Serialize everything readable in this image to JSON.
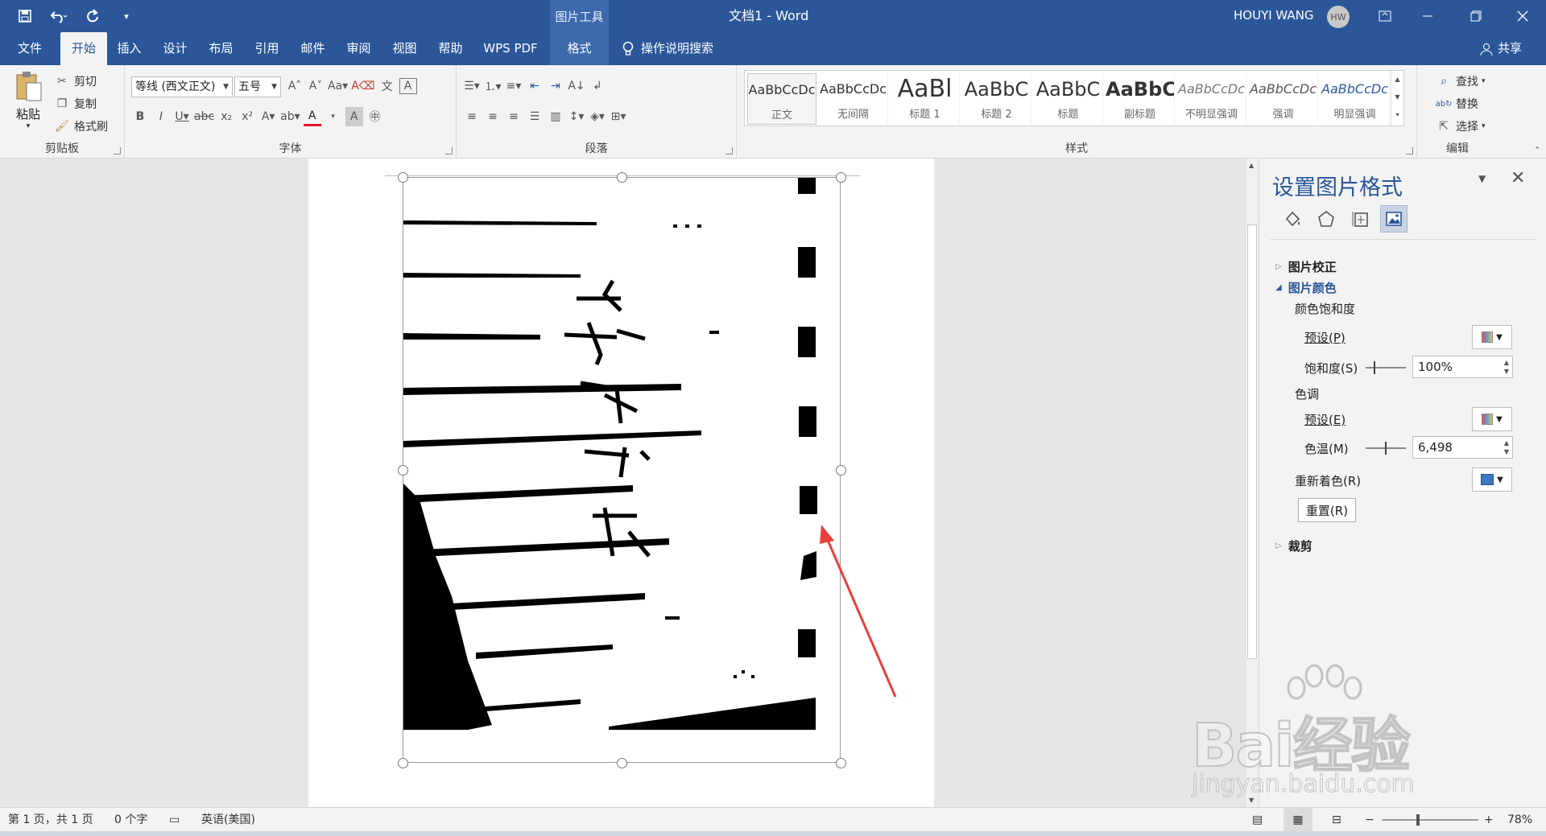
{
  "titlebar": {
    "tool_tab": "图片工具",
    "doc_title": "文档1 - Word",
    "user": "HOUYI WANG",
    "avatar": "HW"
  },
  "tabs": [
    "文件",
    "开始",
    "插入",
    "设计",
    "布局",
    "引用",
    "邮件",
    "审阅",
    "视图",
    "帮助",
    "WPS PDF",
    "格式"
  ],
  "search": "操作说明搜索",
  "share": "共享",
  "clipboard": {
    "paste": "粘贴",
    "cut": "剪切",
    "copy": "复制",
    "painter": "格式刷",
    "group": "剪贴板"
  },
  "font": {
    "name": "等线 (西文正文)",
    "size": "五号",
    "group": "字体"
  },
  "paragraph": {
    "group": "段落"
  },
  "styles": {
    "group": "样式",
    "items": [
      {
        "preview": "AaBbCcDc",
        "name": "正文"
      },
      {
        "preview": "AaBbCcDc",
        "name": "无间隔"
      },
      {
        "preview": "AaBl",
        "name": "标题 1"
      },
      {
        "preview": "AaBbC",
        "name": "标题 2"
      },
      {
        "preview": "AaBbC",
        "name": "标题"
      },
      {
        "preview": "AaBbC",
        "name": "副标题"
      },
      {
        "preview": "AaBbCcDc",
        "name": "不明显强调"
      },
      {
        "preview": "AaBbCcDc",
        "name": "强调"
      },
      {
        "preview": "AaBbCcDc",
        "name": "明显强调"
      }
    ]
  },
  "editing": {
    "find": "查找",
    "replace": "替换",
    "select": "选择",
    "group": "编辑"
  },
  "pane": {
    "title": "设置图片格式",
    "correction": "图片校正",
    "color": "图片颜色",
    "saturation_h": "颜色饱和度",
    "preset_p": "预设(P)",
    "saturation_s": "饱和度(S)",
    "saturation_val": "100%",
    "tone": "色调",
    "preset_e": "预设(E)",
    "temp": "色温(M)",
    "temp_val": "6,498",
    "recolor": "重新着色(R)",
    "reset": "重置(R)",
    "crop": "裁剪"
  },
  "status": {
    "page": "第 1 页，共 1 页",
    "words": "0 个字",
    "lang": "英语(美国)",
    "zoom": "78%"
  },
  "watermark": {
    "logo": "Bai经验",
    "url": "jingyan.baidu.com"
  },
  "colors": {
    "accent": "#2b579a",
    "arrow": "#e8403c"
  }
}
